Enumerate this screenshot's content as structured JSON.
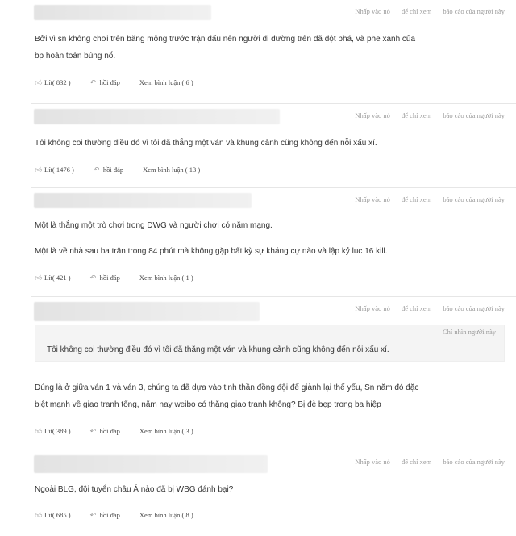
{
  "actions": {
    "click": "Nhấp vào nó",
    "only": "để chỉ xem",
    "report": "báo cáo của người này"
  },
  "comments": [
    {
      "lines": [
        "Bởi vì sn không chơi trên băng mỏng trước trận đấu nên người đi đường trên đã đột phá, và phe xanh của",
        "bp hoàn toàn bùng nổ."
      ],
      "likes": "Lít( 832 )",
      "reply": "hồi đáp",
      "view": "Xem bình luận ( 6 )"
    },
    {
      "lines": [
        "Tôi không coi thường điều đó vì tôi đã thắng một ván và khung cảnh cũng không đến nỗi xấu xí."
      ],
      "likes": "Lít( 1476 )",
      "reply": "hồi đáp",
      "view": "Xem bình luận ( 13 )"
    },
    {
      "lines": [
        "Một là thắng một trò chơi trong DWG và người chơi có năm mạng.",
        "Một là về nhà sau ba trận trong 84 phút mà không gặp bất kỳ sự kháng cự nào và lập kỷ lục 16 kill."
      ],
      "likes": "Lít( 421 )",
      "reply": "hồi đáp",
      "view": "Xem bình luận ( 1 )"
    },
    {
      "quote_head": "Chỉ nhìn người này",
      "quote_text": "Tôi không coi thường điều đó vì tôi đã thắng một ván và khung cảnh cũng không đến nỗi xấu xí.",
      "lines": [
        "Đúng là ở giữa ván 1 và ván 3, chúng ta đã dựa vào tinh thần đồng đội để giành lại thế yếu, Sn năm đó đặc",
        "biệt mạnh về giao tranh tổng, năm nay weibo có thắng giao tranh không? Bị đè bẹp trong ba hiệp"
      ],
      "likes": "Lít( 389 )",
      "reply": "hồi đáp",
      "view": "Xem bình luận ( 3 )"
    },
    {
      "lines": [
        "Ngoài BLG, đội tuyển châu Á nào đã bị WBG đánh bại?"
      ],
      "likes": "Lít( 685 )",
      "reply": "hồi đáp",
      "view": "Xem bình luận ( 8 )"
    }
  ],
  "icons": {
    "like": "thumb-up-icon",
    "reply": "reply-arrow-icon"
  }
}
